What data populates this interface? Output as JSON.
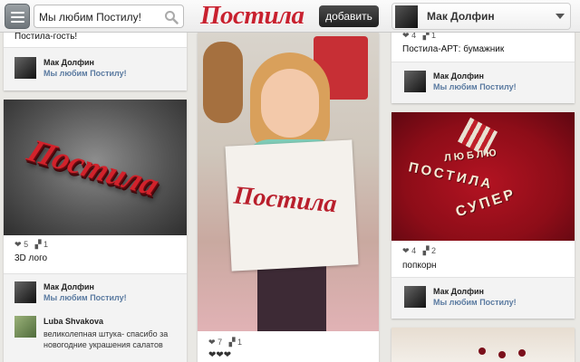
{
  "header": {
    "search_value": "Мы любим Постилу!",
    "logo": "Постила",
    "add_label": "добавить",
    "user_name": "Мак Долфин"
  },
  "col1": {
    "top_caption": "Постила-гость!",
    "top_comment": {
      "name": "Мак Долфин",
      "text": "Мы любим Постилу!"
    },
    "card": {
      "image_text": "Постила",
      "likes": "5",
      "reposts": "1",
      "caption": "3D лого",
      "comments": [
        {
          "name": "Мак Долфин",
          "text": "Мы любим Постилу!"
        },
        {
          "name": "Luba Shvakova",
          "text": "великолепная штука- спасибо за новогодние украшения салатов"
        }
      ]
    }
  },
  "col2": {
    "card": {
      "sign_text": "Постила",
      "likes": "7",
      "reposts": "1",
      "caption": "❤❤❤"
    }
  },
  "col3": {
    "top_stats": {
      "likes": "4",
      "reposts": "1"
    },
    "top_caption": "Постила-АРТ: бумажник",
    "top_comment": {
      "name": "Мак Долфин",
      "text": "Мы любим Постилу!"
    },
    "card": {
      "image_words": [
        "ЛЮБЛЮ",
        "ПОСТИЛА",
        "СУПЕР"
      ],
      "likes": "4",
      "reposts": "2",
      "caption": "попкорн",
      "comment": {
        "name": "Мак Долфин",
        "text": "Мы любим Постилу!"
      }
    }
  },
  "colors": {
    "brand": "#c8212f",
    "background": "#e9e8e4",
    "link": "#5a7aa0"
  }
}
